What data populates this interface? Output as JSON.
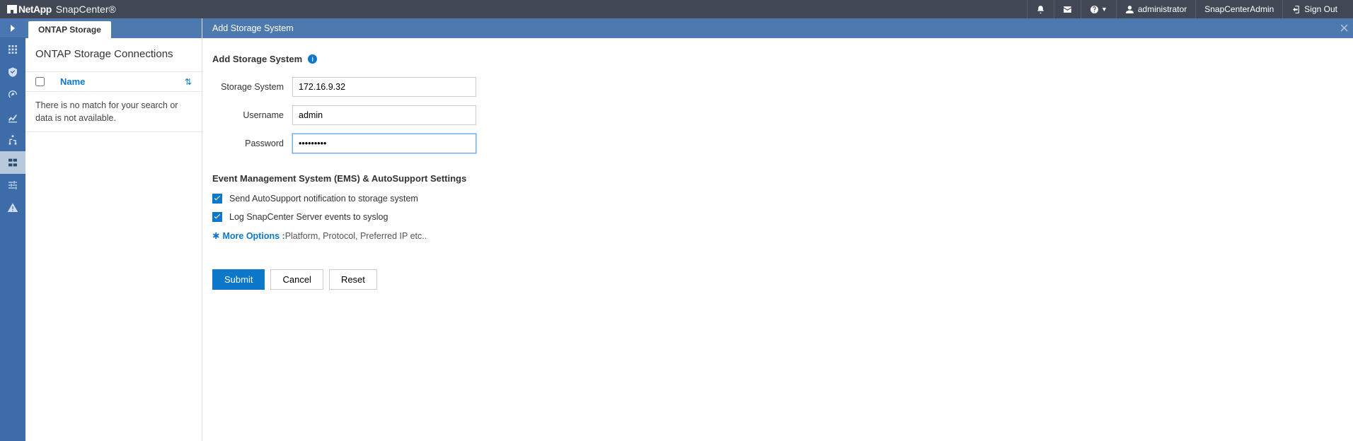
{
  "header": {
    "brand_prefix": "NetApp",
    "brand_app": "SnapCenter®",
    "user": "administrator",
    "role": "SnapCenterAdmin",
    "signout": "Sign Out"
  },
  "mid_panel": {
    "tab": "ONTAP Storage",
    "title": "ONTAP Storage Connections",
    "column_name": "Name",
    "empty_msg": "There is no match for your search or data is not available."
  },
  "main": {
    "header": "Add Storage System",
    "section_title": "Add Storage System",
    "fields": {
      "storage_system_label": "Storage System",
      "storage_system_value": "172.16.9.32",
      "username_label": "Username",
      "username_value": "admin",
      "password_label": "Password",
      "password_value": "•••••••••"
    },
    "ems_section": "Event Management System (EMS) & AutoSupport Settings",
    "chk_autosupport": "Send AutoSupport notification to storage system",
    "chk_syslog": "Log SnapCenter Server events to syslog",
    "more_options_label": "More Options :",
    "more_options_desc": " Platform, Protocol, Preferred IP etc..",
    "buttons": {
      "submit": "Submit",
      "cancel": "Cancel",
      "reset": "Reset"
    }
  }
}
